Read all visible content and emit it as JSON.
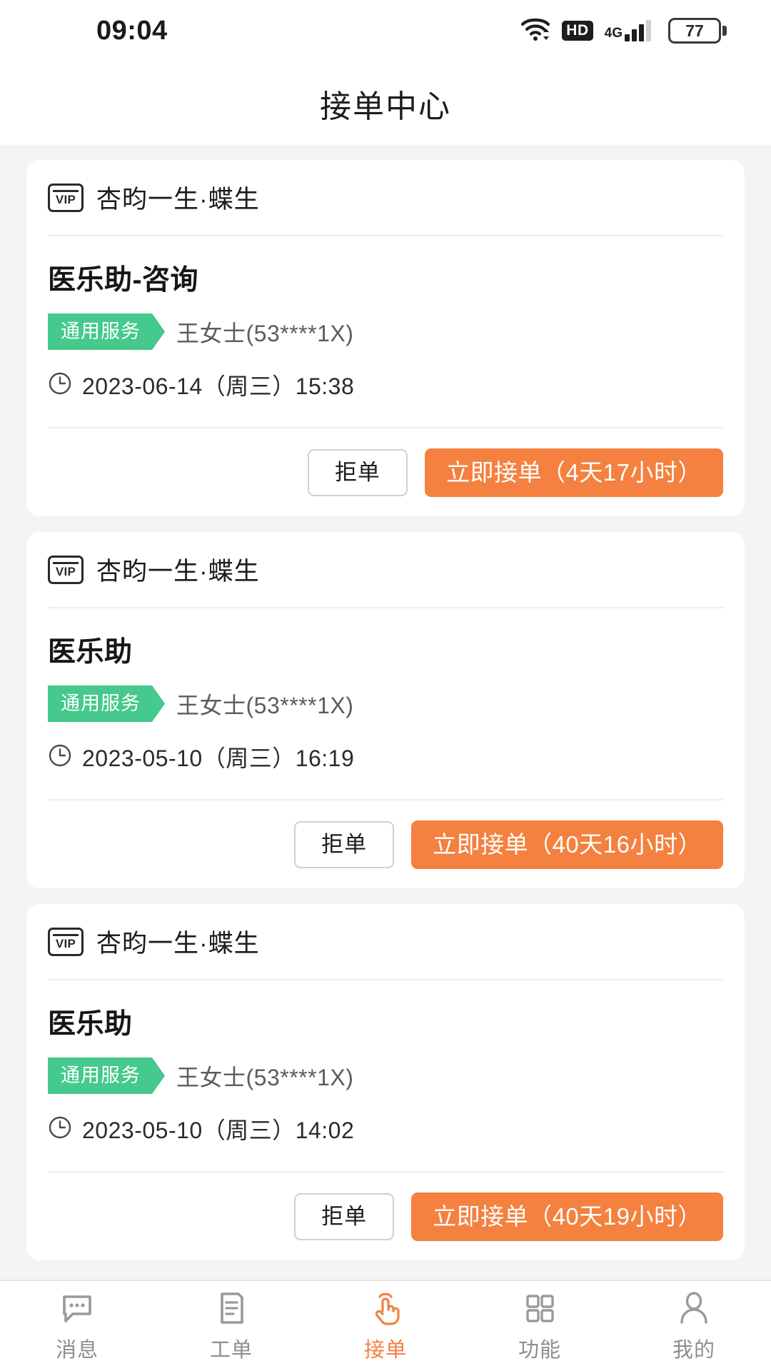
{
  "statusbar": {
    "time": "09:04",
    "hd_label": "HD",
    "network_label": "4G",
    "battery_level": "77",
    "icons": [
      "wifi-icon",
      "hd-icon",
      "signal-4g-icon",
      "battery-icon"
    ]
  },
  "header": {
    "title": "接单中心"
  },
  "orders": [
    {
      "merchant": "杏昀一生·蝶生",
      "vip_label": "VIP",
      "service_title": "医乐助-咨询",
      "service_tag": "通用服务",
      "customer": "王女士(53****1X)",
      "datetime": "2023-06-14（周三）15:38",
      "reject_label": "拒单",
      "accept_label": "立即接单（4天17小时）"
    },
    {
      "merchant": "杏昀一生·蝶生",
      "vip_label": "VIP",
      "service_title": "医乐助",
      "service_tag": "通用服务",
      "customer": "王女士(53****1X)",
      "datetime": "2023-05-10（周三）16:19",
      "reject_label": "拒单",
      "accept_label": "立即接单（40天16小时）"
    },
    {
      "merchant": "杏昀一生·蝶生",
      "vip_label": "VIP",
      "service_title": "医乐助",
      "service_tag": "通用服务",
      "customer": "王女士(53****1X)",
      "datetime": "2023-05-10（周三）14:02",
      "reject_label": "拒单",
      "accept_label": "立即接单（40天19小时）"
    }
  ],
  "tabbar": {
    "items": [
      {
        "label": "消息",
        "icon": "chat-bubble-icon",
        "active": false
      },
      {
        "label": "工单",
        "icon": "document-icon",
        "active": false
      },
      {
        "label": "接单",
        "icon": "tap-hand-icon",
        "active": true
      },
      {
        "label": "功能",
        "icon": "grid-icon",
        "active": false
      },
      {
        "label": "我的",
        "icon": "person-icon",
        "active": false
      }
    ]
  },
  "colors": {
    "accent_orange": "#f4813f",
    "tag_green": "#46c98c",
    "page_background": "#f4f4f4",
    "card_background": "#ffffff",
    "muted_text": "#8e8e8e"
  }
}
